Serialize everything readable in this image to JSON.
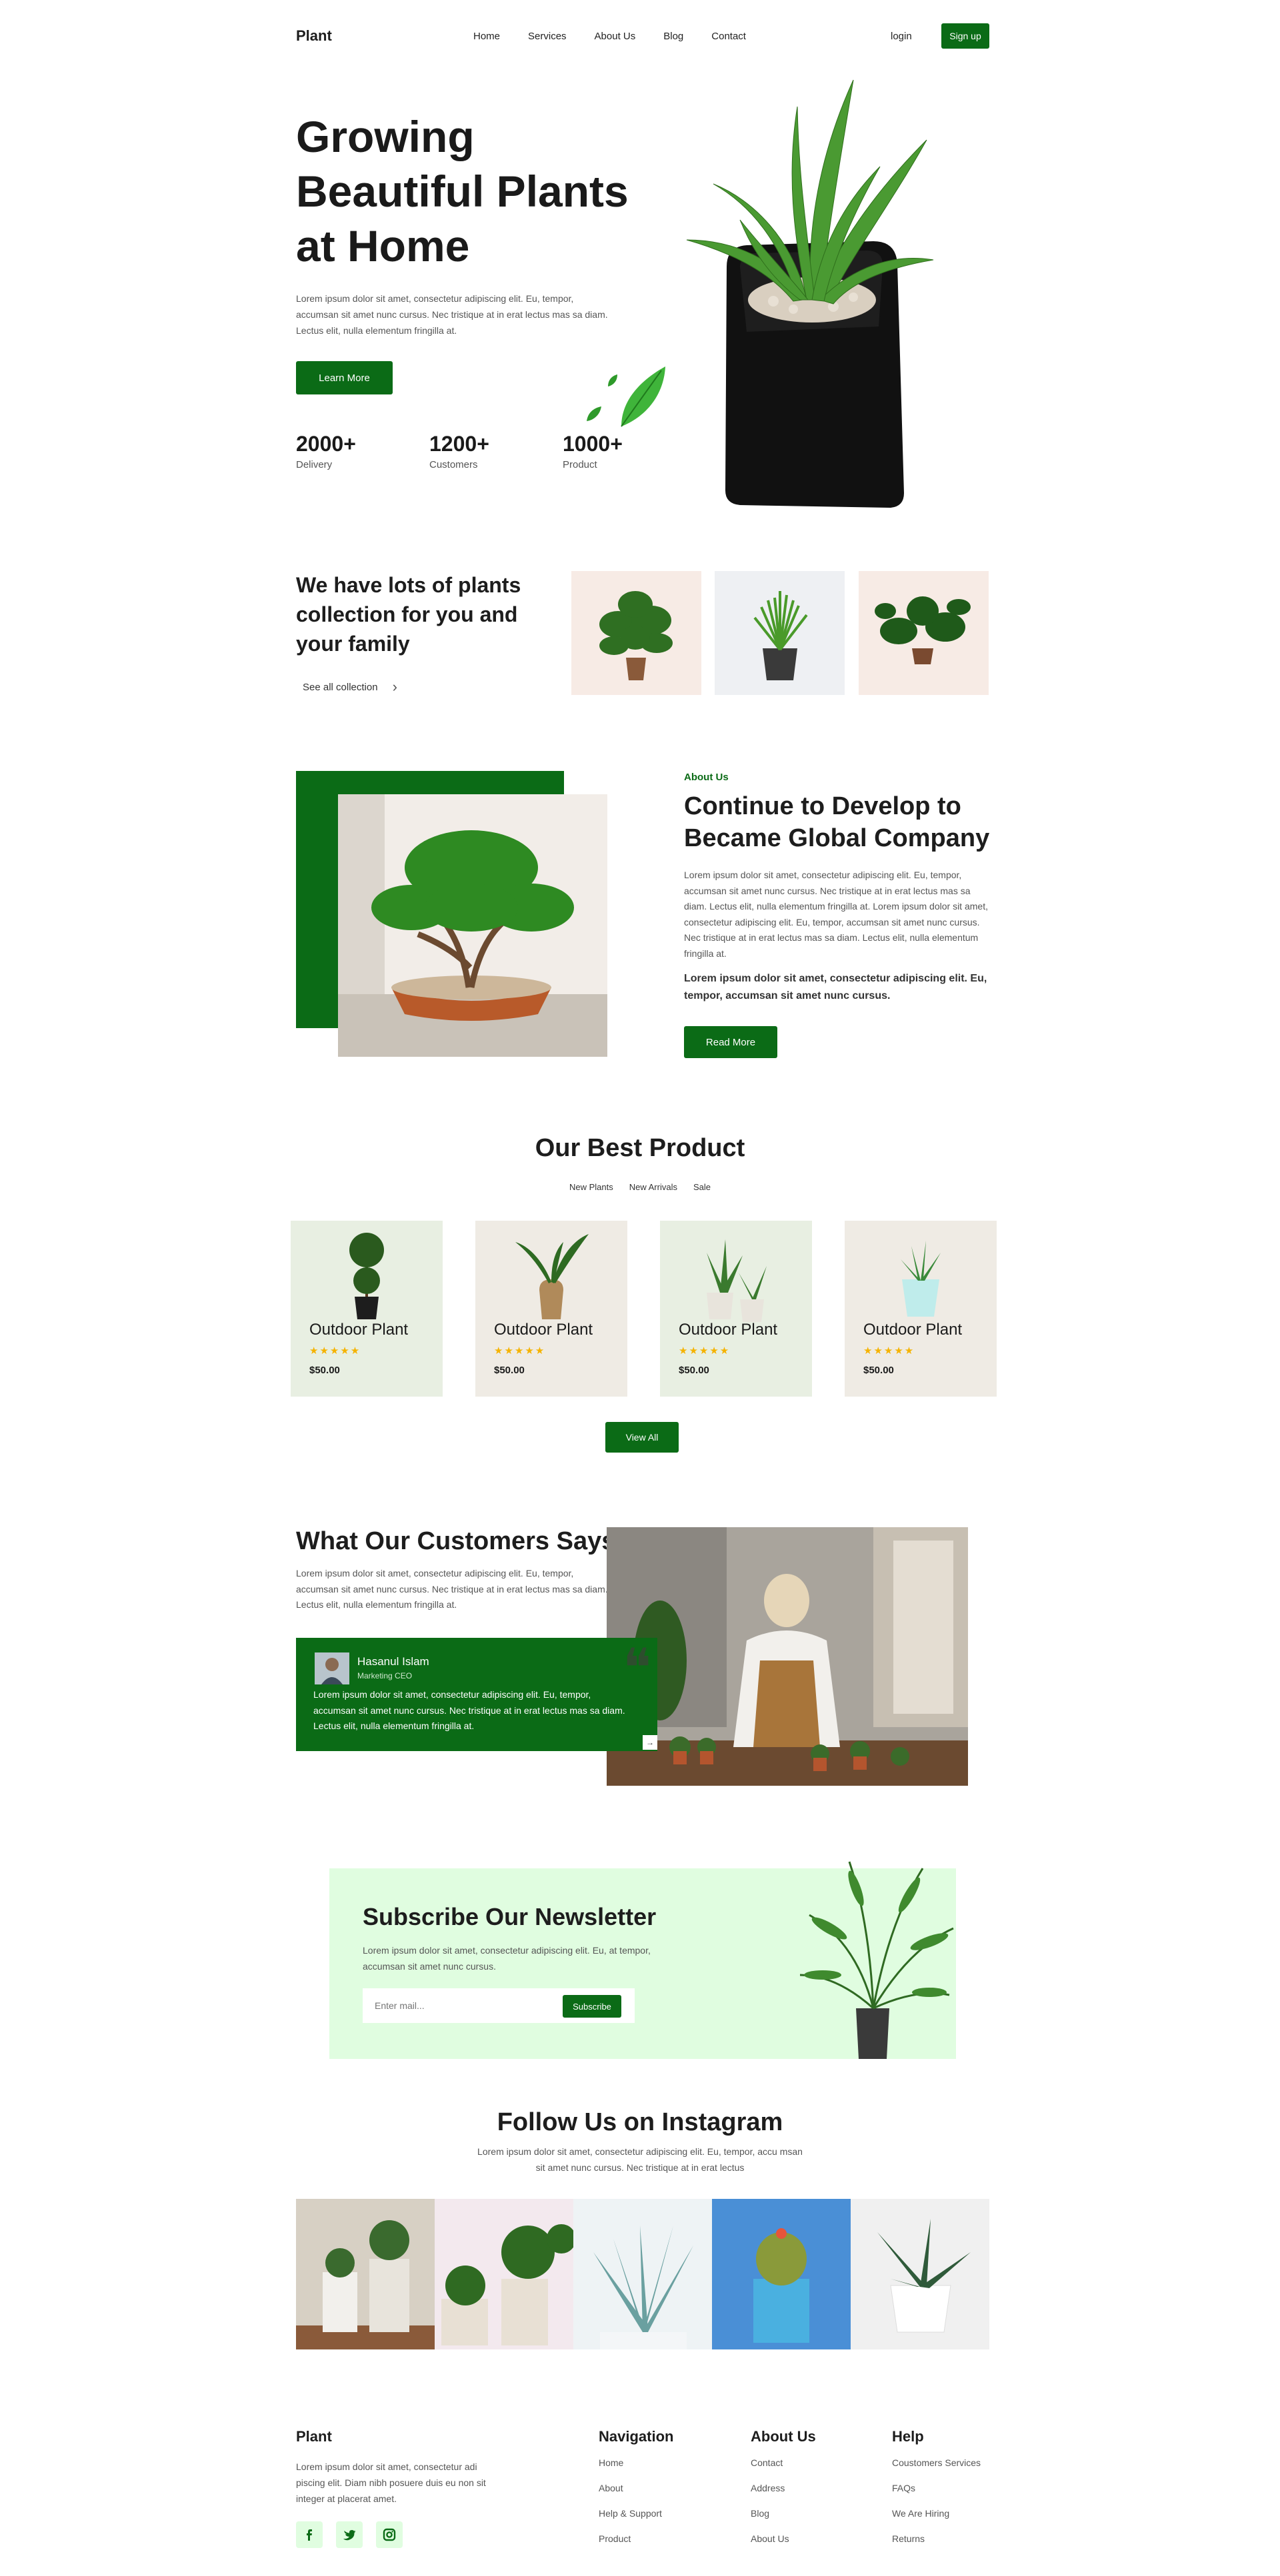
{
  "colors": {
    "brand_green": "#0b6b16",
    "newsletter_bg": "#e0fde0",
    "star": "#f5b300"
  },
  "nav": {
    "logo": "Plant",
    "links": [
      "Home",
      "Services",
      "About Us",
      "Blog",
      "Contact"
    ],
    "login": "login",
    "signup": "Sign up"
  },
  "hero": {
    "title": "Growing Beautiful Plants at Home",
    "text": "Lorem ipsum dolor sit amet, consectetur adipiscing elit. Eu, tempor, accumsan sit amet nunc cursus. Nec tristique at in erat lectus mas sa diam. Lectus elit, nulla elementum fringilla at.",
    "button": "Learn More",
    "stats": [
      {
        "value": "2000+",
        "label": "Delivery"
      },
      {
        "value": "1200+",
        "label": "Customers"
      },
      {
        "value": "1000+",
        "label": "Product"
      }
    ]
  },
  "collection": {
    "title": "We have lots of plants collection for you and your family",
    "link": "See all collection"
  },
  "about": {
    "label": "About Us",
    "title": "Continue to Develop to Became Global Company",
    "text": "Lorem ipsum dolor sit amet, consectetur adipiscing elit. Eu, tempor, accumsan sit amet nunc cursus. Nec tristique at in erat lectus mas sa diam. Lectus elit, nulla elementum fringilla at. Lorem ipsum dolor sit amet, consectetur adipiscing elit. Eu, tempor, accumsan sit amet nunc cursus. Nec tristique at in erat lectus mas sa diam. Lectus elit, nulla elementum fringilla at.",
    "bold_text": "Lorem ipsum dolor sit amet, consectetur adipiscing elit. Eu, tempor, accumsan sit amet nunc cursus.",
    "button": "Read More"
  },
  "products": {
    "title": "Our Best Product",
    "tabs": [
      "New Plants",
      "New Arrivals",
      "Sale"
    ],
    "items": [
      {
        "name": "Outdoor Plant",
        "stars": "★★★★★",
        "price": "$50.00"
      },
      {
        "name": "Outdoor Plant",
        "stars": "★★★★★",
        "price": "$50.00"
      },
      {
        "name": "Outdoor Plant",
        "stars": "★★★★★",
        "price": "$50.00"
      },
      {
        "name": "Outdoor Plant",
        "stars": "★★★★★",
        "price": "$50.00"
      }
    ],
    "view_all": "View All"
  },
  "testimonial": {
    "title": "What Our Customers Says",
    "text": "Lorem ipsum dolor sit amet, consectetur adipiscing elit. Eu, tempor, accumsan sit amet nunc cursus. Nec tristique at in erat lectus mas sa diam. Lectus elit, nulla elementum fringilla at.",
    "name": "Hasanul Islam",
    "role": "Marketing CEO",
    "quote": "Lorem ipsum dolor sit amet, consectetur adipiscing elit. Eu, tempor, accumsan sit amet nunc cursus. Nec tristique at in erat lectus mas sa diam. Lectus elit, nulla elementum fringilla at.",
    "next_arrow": "→"
  },
  "newsletter": {
    "title": "Subscribe Our Newsletter",
    "text": "Lorem ipsum dolor sit amet, consectetur adipiscing elit. Eu, at tempor, accumsan sit amet nunc cursus.",
    "placeholder": "Enter mail...",
    "button": "Subscribe"
  },
  "instagram": {
    "title": "Follow Us on Instagram",
    "text": "Lorem ipsum dolor sit amet, consectetur adipiscing elit. Eu, tempor, accu msan sit amet nunc cursus. Nec tristique at in erat lectus"
  },
  "footer": {
    "brand": "Plant",
    "text": "Lorem ipsum dolor sit amet, consectetur adi piscing elit. Diam nibh posuere duis eu non sit integer at placerat amet.",
    "social_icons": [
      "facebook-icon",
      "twitter-icon",
      "instagram-icon"
    ],
    "columns": [
      {
        "title": "Navigation",
        "links": [
          "Home",
          "About",
          "Help & Support",
          "Product"
        ]
      },
      {
        "title": "About Us",
        "links": [
          "Contact",
          "Address",
          "Blog",
          "About Us"
        ]
      },
      {
        "title": "Help",
        "links": [
          "Coustomers Services",
          "FAQs",
          "We Are Hiring",
          "Returns"
        ]
      }
    ]
  }
}
